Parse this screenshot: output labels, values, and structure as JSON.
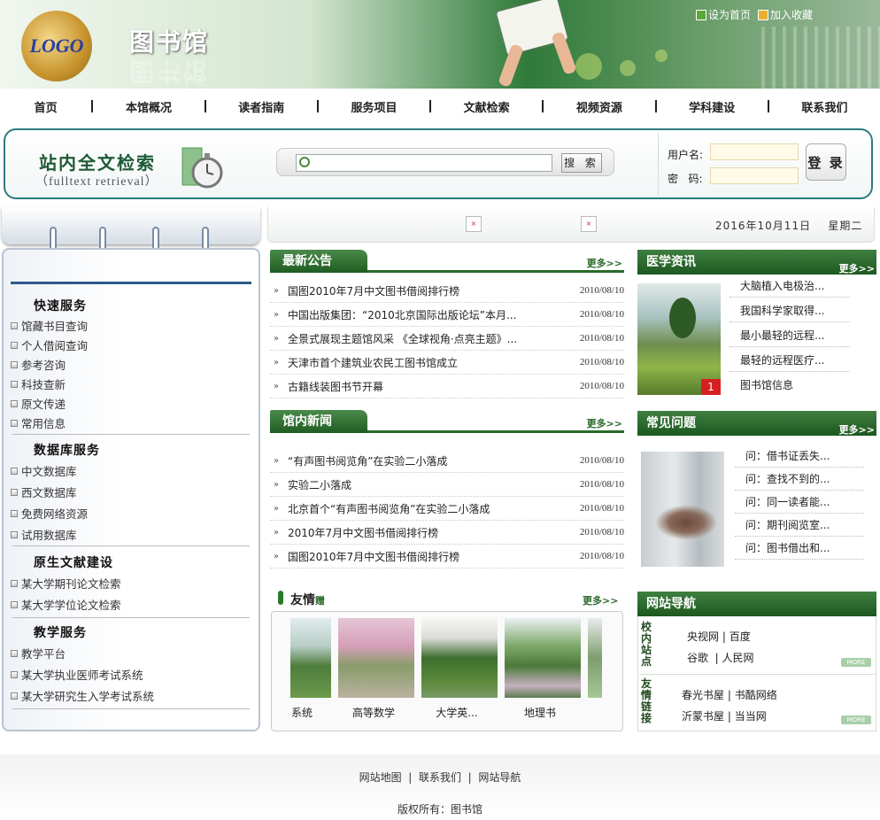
{
  "header": {
    "logo_text": "LOGO",
    "site_name": "图书馆",
    "set_home": "设为首页",
    "add_favorite": "加入收藏"
  },
  "nav": [
    "首页",
    "本馆概况",
    "读者指南",
    "服务项目",
    "文献检索",
    "视频资源",
    "学科建设",
    "联系我们"
  ],
  "search": {
    "title": "站内全文检索",
    "subtitle": "（fulltext retrieval）",
    "input_value": "",
    "button": "搜 索"
  },
  "login": {
    "username_label": "用户名:",
    "password_label": "密   码:",
    "button": "登 录"
  },
  "date": "2016年10月11日",
  "weekday": "星期二",
  "sidebar": {
    "quick": {
      "title": "快速服务",
      "items": [
        "馆藏书目查询",
        "个人借阅查询",
        "参考咨询",
        "科技查新",
        "原文传递",
        "常用信息"
      ]
    },
    "db": {
      "title": "数据库服务",
      "items": [
        "中文数据库",
        "西文数据库",
        "免费网络资源",
        "试用数据库"
      ]
    },
    "native": {
      "title": "原生文献建设",
      "items": [
        "某大学期刊论文检索",
        "某大学学位论文检索"
      ]
    },
    "teach": {
      "title": "教学服务",
      "items": [
        "教学平台",
        "某大学执业医师考试系统",
        "某大学研究生入学考试系统"
      ]
    }
  },
  "announcements": {
    "title": "最新公告",
    "more": "更多>>",
    "items": [
      {
        "title": "国图2010年7月中文图书借阅排行榜",
        "date": "2010/08/10"
      },
      {
        "title": "中国出版集团：“2010北京国际出版论坛”本月...",
        "date": "2010/08/10"
      },
      {
        "title": "全景式展现主题馆风采 《全球视角·点亮主题》...",
        "date": "2010/08/10"
      },
      {
        "title": "天津市首个建筑业农民工图书馆成立",
        "date": "2010/08/10"
      },
      {
        "title": "古籍线装图书节开幕",
        "date": "2010/08/10"
      }
    ]
  },
  "news": {
    "title": "馆内新闻",
    "more": "更多>>",
    "items": [
      {
        "title": "“有声图书阅览角”在实验二小落成",
        "date": "2010/08/10"
      },
      {
        "title": "实验二小落成",
        "date": "2010/08/10"
      },
      {
        "title": "北京首个“有声图书阅览角”在实验二小落成",
        "date": "2010/08/10"
      },
      {
        "title": "2010年7月中文图书借阅排行榜",
        "date": "2010/08/10"
      },
      {
        "title": "国图2010年7月中文图书借阅排行榜",
        "date": "2010/08/10"
      }
    ]
  },
  "friends": {
    "title": "友情",
    "subtitle": "赠",
    "more": "更多>>",
    "captions": [
      "系统",
      "高等数学",
      "大学英...",
      "地理书"
    ]
  },
  "medical": {
    "title": "医学资讯",
    "more": "更多>>",
    "badge": "1",
    "items": [
      "大脑植入电极治...",
      "我国科学家取得...",
      "最小最轻的远程...",
      "最轻的远程医疗...",
      "图书馆信息"
    ]
  },
  "faq": {
    "title": "常见问题",
    "more": "更多>>",
    "items": [
      "问：借书证丢失...",
      "问：查找不到的...",
      "问：同一读者能...",
      "问：期刊阅览室...",
      "问：图书借出和..."
    ]
  },
  "sitenav": {
    "title": "网站导航",
    "campus_label": "校内站点",
    "campus_row1": [
      "央视网",
      "百度"
    ],
    "campus_row2": [
      "谷歌",
      "人民网"
    ],
    "friend_label": "友情链接",
    "friend_row1": [
      "春光书屋",
      "书酷网络"
    ],
    "friend_row2": [
      "沂蒙书屋",
      "当当网"
    ],
    "more": "MORE"
  },
  "footer": {
    "links": [
      "网站地图",
      "联系我们",
      "网站导航"
    ],
    "copyright": "版权所有：图书馆"
  },
  "colors": {
    "green": "#2a6a2a",
    "teal_border": "#2d7b7e",
    "badge_red": "#d52020"
  }
}
